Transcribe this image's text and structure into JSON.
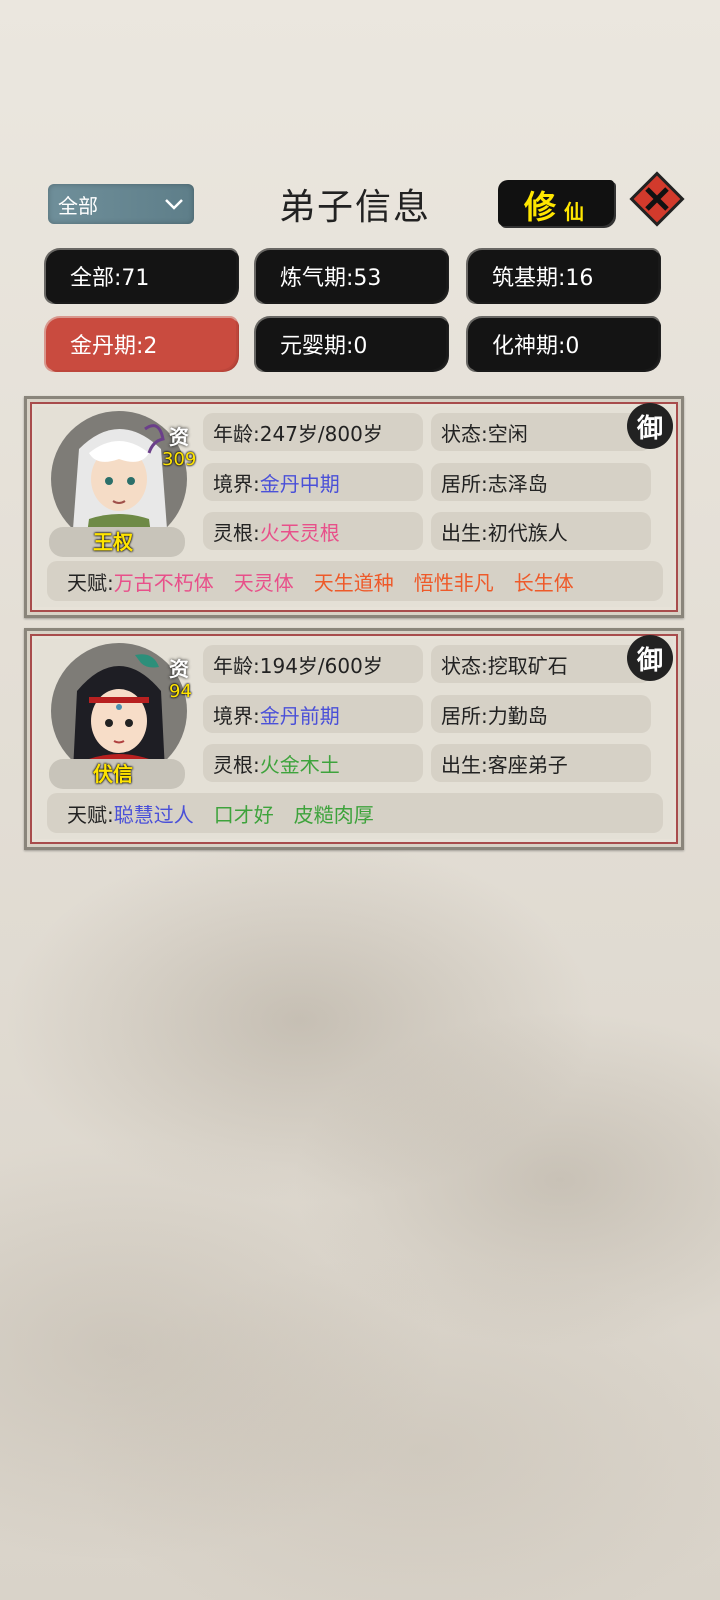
{
  "header": {
    "filter_label": "全部",
    "title": "弟子信息",
    "xiu_big": "修",
    "xiu_small": "仙"
  },
  "stages": [
    {
      "label": "全部:71"
    },
    {
      "label": "炼气期:53"
    },
    {
      "label": "筑基期:16"
    },
    {
      "label": "金丹期:2",
      "active": true
    },
    {
      "label": "元婴期:0"
    },
    {
      "label": "化神期:0"
    }
  ],
  "disciples": [
    {
      "name": "王权",
      "zi_label": "资",
      "zi_value": "309",
      "age_label": "年龄:",
      "age": "247岁/800岁",
      "status_label": "状态:",
      "status": "空闲",
      "realm_label": "境界:",
      "realm": "金丹中期",
      "home_label": "居所:",
      "home": "志泽岛",
      "root_label": "灵根:",
      "root": "火天灵根",
      "birth_label": "出生:",
      "birth": "初代族人",
      "talent_label": "天赋:",
      "talents": [
        "万古不朽体",
        "天灵体",
        "天生道种",
        "悟性非凡",
        "长生体"
      ],
      "talent_colors": [
        "#e8508a",
        "#e8508a",
        "#ee5a2a",
        "#ee5a2a",
        "#ee5a2a"
      ],
      "badge": "御"
    },
    {
      "name": "伏信",
      "zi_label": "资",
      "zi_value": "94",
      "age_label": "年龄:",
      "age": "194岁/600岁",
      "status_label": "状态:",
      "status": "挖取矿石",
      "realm_label": "境界:",
      "realm": "金丹前期",
      "home_label": "居所:",
      "home": "力勤岛",
      "root_label": "灵根:",
      "root": "火金木土",
      "birth_label": "出生:",
      "birth": "客座弟子",
      "talent_label": "天赋:",
      "talents": [
        "聪慧过人",
        "口才好",
        "皮糙肉厚"
      ],
      "talent_colors": [
        "#4a50d8",
        "#3ea33c",
        "#3ea33c"
      ],
      "badge": "御"
    }
  ]
}
